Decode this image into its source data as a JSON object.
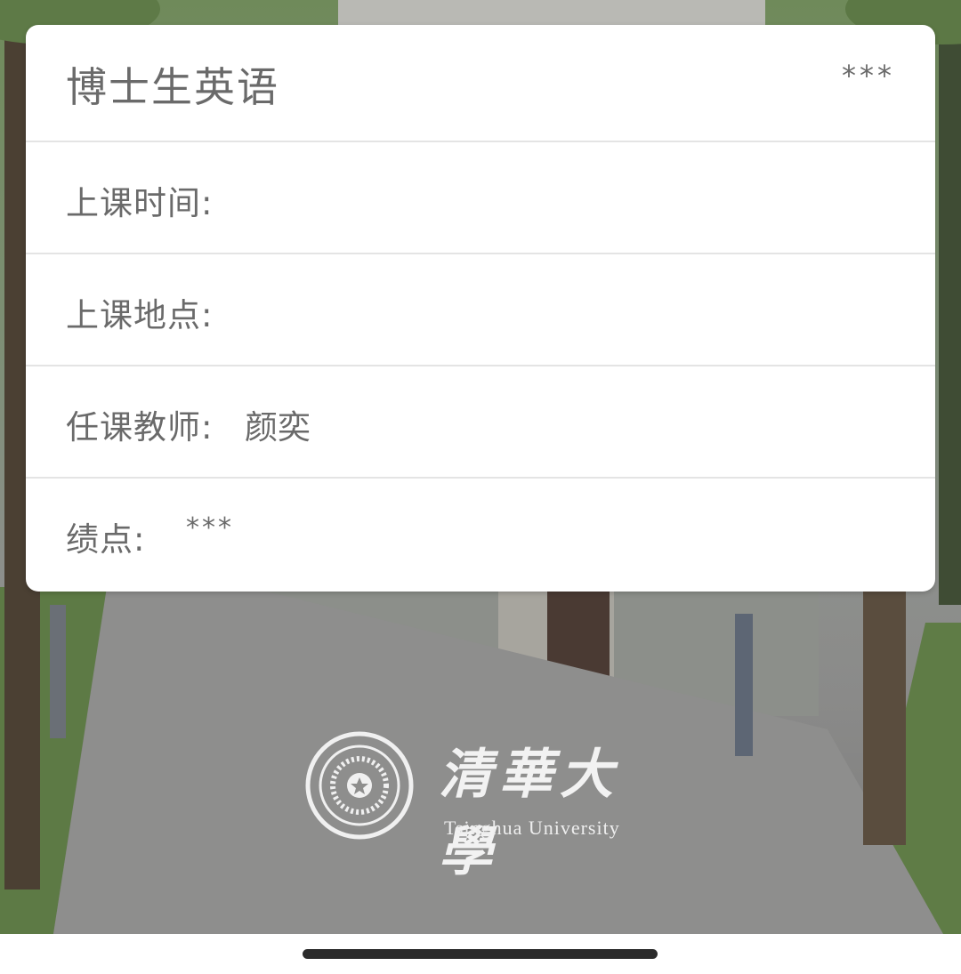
{
  "course": {
    "title": "博士生英语",
    "score": "***"
  },
  "rows": {
    "time_label": "上课时间:",
    "place_label": "上课地点:",
    "teacher_label": "任课教师:",
    "teacher_value": "颜奕",
    "gpa_label": "绩点:",
    "gpa_value": "***"
  },
  "background": {
    "university_cn": "清華大學",
    "university_en": "Tsinghua University"
  },
  "colors": {
    "text": "#6a6a6a",
    "card": "#ffffff",
    "divider": "#e4e4e4"
  }
}
